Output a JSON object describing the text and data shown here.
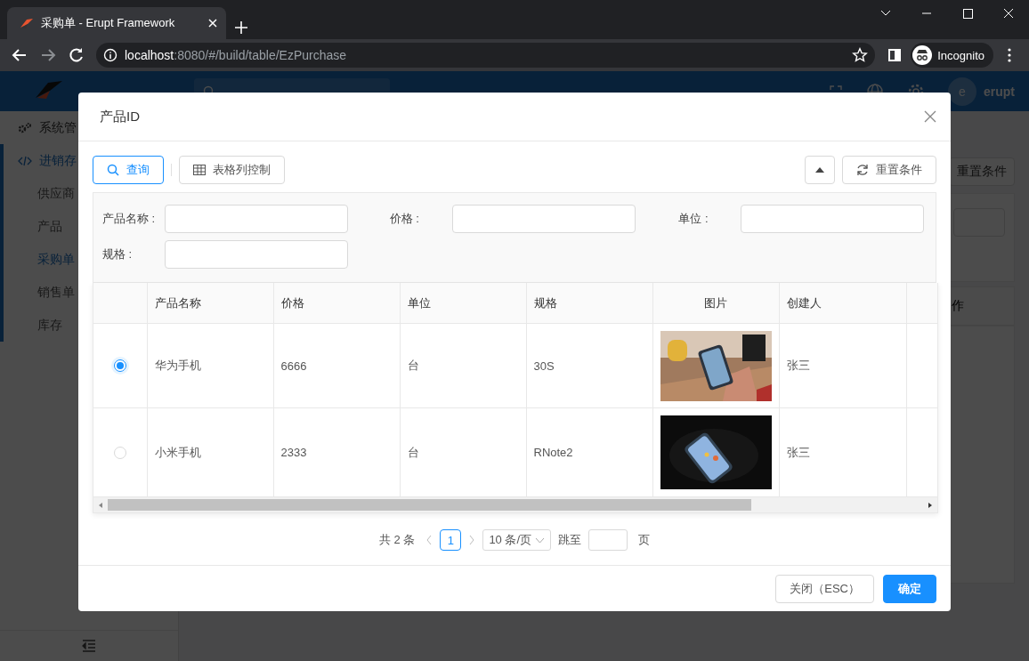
{
  "browser": {
    "tab_title": "采购单 - Erupt Framework",
    "url_host": "localhost",
    "url_rest": ":8080/#/build/table/EzPurchase",
    "profile": "Incognito"
  },
  "app": {
    "avatar_letter": "e",
    "user": "erupt",
    "sidebar": [
      {
        "label": "系统管",
        "expanded": false,
        "selected": false
      },
      {
        "label": "进销存",
        "expanded": true,
        "selected": true,
        "children": [
          {
            "label": "供应商",
            "selected": false
          },
          {
            "label": "产品",
            "selected": false
          },
          {
            "label": "采购单",
            "selected": true
          },
          {
            "label": "销售单",
            "selected": false
          },
          {
            "label": "库存",
            "selected": false
          }
        ]
      }
    ],
    "reset_button": "重置条件",
    "column_fragment": "作"
  },
  "modal": {
    "title": "产品ID",
    "toolbar": {
      "query": "查询",
      "columns": "表格列控制",
      "reset": "重置条件"
    },
    "filters": [
      {
        "label": "产品名称 :"
      },
      {
        "label": "价格 :"
      },
      {
        "label": "单位 :"
      },
      {
        "label": "规格 :"
      }
    ],
    "table": {
      "columns": [
        "产品名称",
        "价格",
        "单位",
        "规格",
        "图片",
        "创建人"
      ],
      "rows": [
        {
          "selected": true,
          "cells": [
            {
              "kind": "text",
              "text": "华为手机"
            },
            {
              "kind": "text",
              "text": "6666"
            },
            {
              "kind": "text",
              "text": "台"
            },
            {
              "kind": "text",
              "text": "30S"
            },
            {
              "kind": "picture"
            },
            {
              "kind": "text",
              "text": "张三"
            }
          ]
        },
        {
          "selected": false,
          "cells": [
            {
              "kind": "text",
              "text": "小米手机"
            },
            {
              "kind": "text",
              "text": "2333"
            },
            {
              "kind": "text",
              "text": "台"
            },
            {
              "kind": "text",
              "text": "RNote2"
            },
            {
              "kind": "picture"
            },
            {
              "kind": "text",
              "text": "张三"
            }
          ]
        }
      ]
    },
    "pagination": {
      "total": "共 2 条",
      "pages": [
        {
          "label": "1",
          "selected": true
        }
      ],
      "page_size": "10 条/页",
      "jump": "跳至",
      "page_word": "页"
    },
    "footer": {
      "close": "关闭（ESC）",
      "ok": "确定"
    }
  }
}
